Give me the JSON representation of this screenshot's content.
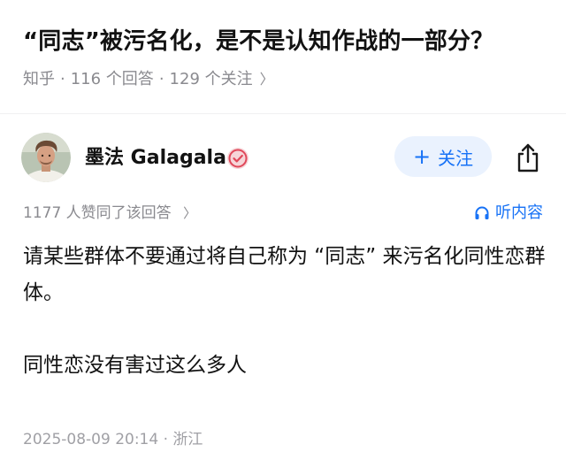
{
  "question": {
    "title": "“同志”被污名化，是不是认知作战的一部分？",
    "source": "知乎",
    "answer_count": "116 个回答",
    "follower_count": "129 个关注",
    "separator": "·",
    "chevron": "〉"
  },
  "author": {
    "name": "墨法 Galagala",
    "follow_plus": "+",
    "follow_label": "关注",
    "avatar_icon": "avatar-photo",
    "badge_icon": "verified-badge-icon",
    "share_icon": "share-icon"
  },
  "stats": {
    "vote_text": "1177 人赞同了该回答",
    "chevron": "〉",
    "listen_label": "听内容",
    "listen_icon": "headphone-icon"
  },
  "answer": {
    "paragraphs": [
      "请某些群体不要通过将自己称为 “同志” 来污名化同性恋群体。",
      "同性恋没有害过这么多人"
    ],
    "time": "2025-08-09 20:14 · 浙江"
  },
  "colors": {
    "accent": "#1772f6",
    "follow_bg": "#eaf2fe",
    "meta_gray": "#8a8a8f",
    "badge_red": "#e0485a"
  }
}
